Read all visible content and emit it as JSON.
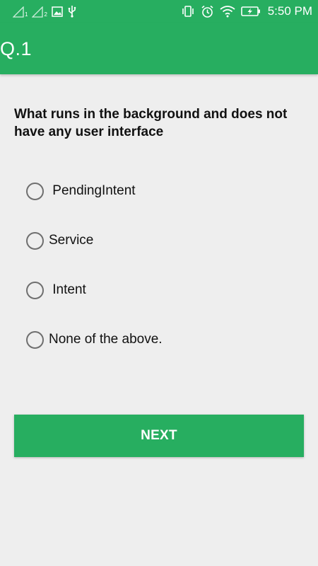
{
  "status_bar": {
    "sim1_label": "1",
    "sim2_label": "2",
    "left_icons": [
      "signal-sim1-icon",
      "signal-sim2-icon",
      "gallery-notification-icon",
      "usb-icon"
    ],
    "right_icons": [
      "vibrate-icon",
      "alarm-icon",
      "wifi-icon",
      "battery-charging-icon"
    ],
    "time": "5:50 PM"
  },
  "app_bar": {
    "title": "Q.1"
  },
  "question": {
    "text": "What runs in the background and does not have any user interface"
  },
  "options": [
    {
      "label": " PendingIntent",
      "selected": false
    },
    {
      "label": "Service",
      "selected": false
    },
    {
      "label": " Intent",
      "selected": false
    },
    {
      "label": "None of the above.",
      "selected": false
    }
  ],
  "next_button": {
    "label": "NEXT"
  },
  "colors": {
    "accent": "#27ae60",
    "background": "#eeeeee",
    "text": "#111111",
    "radio_border": "#6f6f6f"
  }
}
